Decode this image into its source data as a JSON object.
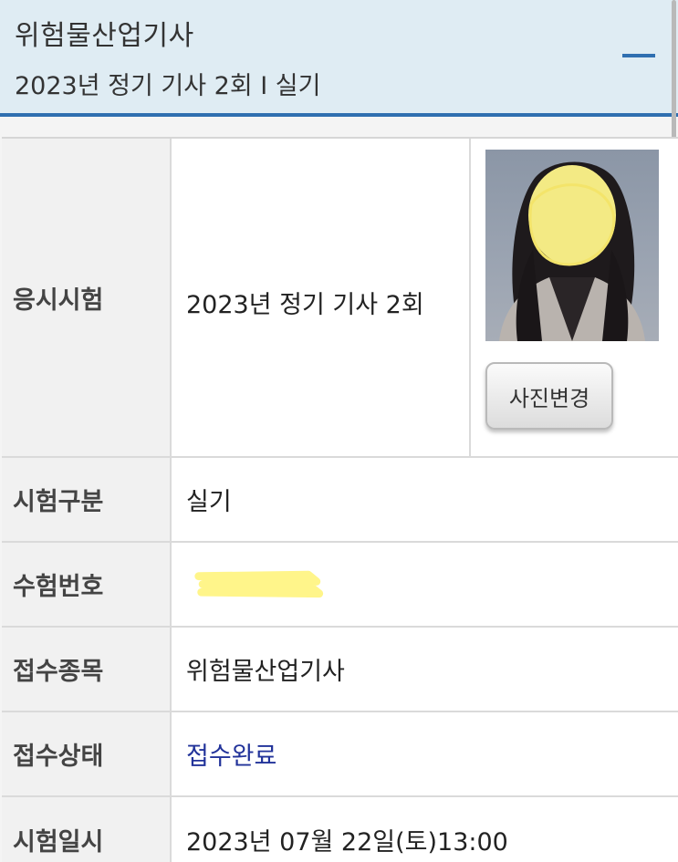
{
  "header": {
    "title": "위험물산업기사",
    "subtitle": "2023년 정기 기사 2회 I 실기"
  },
  "photo_section": {
    "change_photo_label": "사진변경"
  },
  "rows": [
    {
      "label": "응시시험",
      "value": "2023년 정기 기사 2회"
    },
    {
      "label": "시험구분",
      "value": "실기"
    },
    {
      "label": "수험번호",
      "value": ""
    },
    {
      "label": "접수종목",
      "value": "위험물산업기사"
    },
    {
      "label": "접수상태",
      "value": "접수완료"
    },
    {
      "label": "시험일시",
      "value": "2023년 07월 22일(토)13:00"
    }
  ],
  "colors": {
    "header_bg": "#dfecf3",
    "accent": "#2f6fb0",
    "status_link": "#22339a",
    "redaction": "#fff58a"
  }
}
